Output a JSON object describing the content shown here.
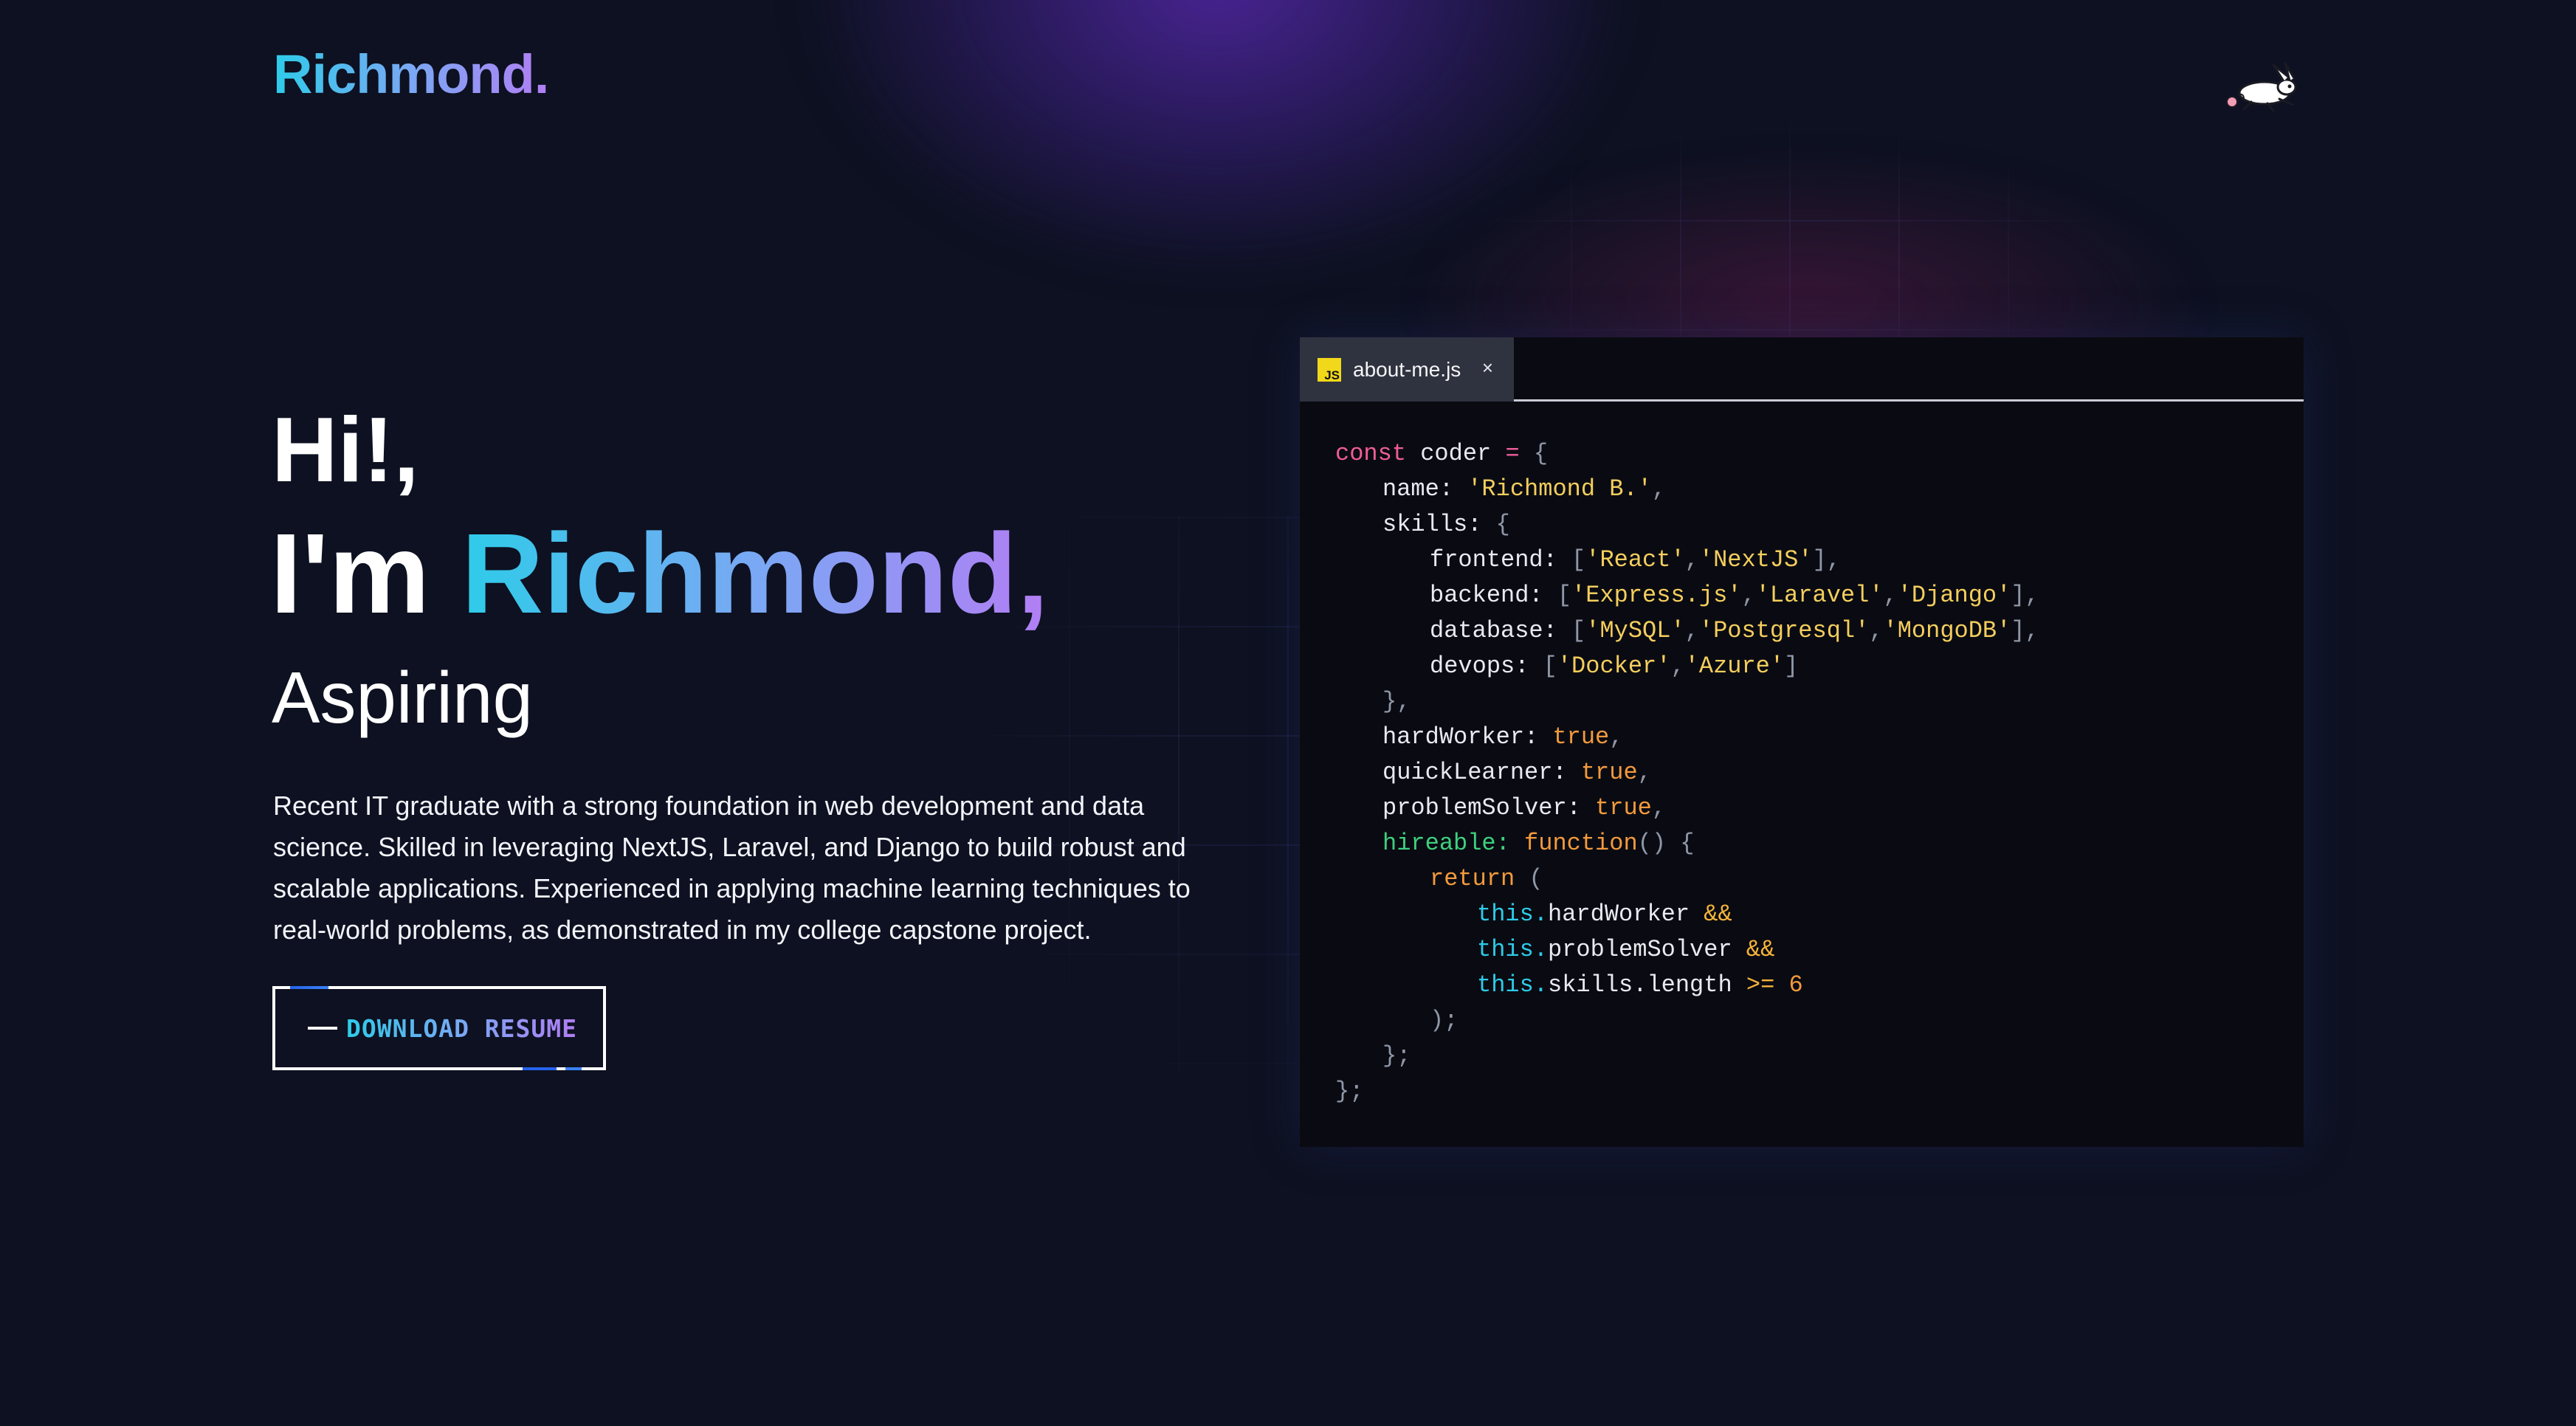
{
  "header": {
    "logo_text": "Richmond",
    "logo_dot": ".",
    "mascot_icon": "rabbit-icon"
  },
  "hero": {
    "greeting": "Hi!,",
    "intro_prefix": "I'm ",
    "name": "Richmond,",
    "role": "Aspiring",
    "bio": "Recent IT graduate with a strong foundation in web development and data science. Skilled in leveraging NextJS, Laravel, and Django to build robust and scalable applications. Experienced in applying machine learning techniques to real-world problems, as demonstrated in my college capstone project.",
    "resume_label": "DOWNLOAD RESUME"
  },
  "editor": {
    "tab_icon_text": "JS",
    "tab_name": "about-me.js",
    "close_glyph": "×",
    "code": {
      "const_kw": "const",
      "var_name": "coder",
      "eq": "=",
      "open_brace": "{",
      "name_key": "name:",
      "name_val": "'Richmond B.'",
      "skills_key": "skills:",
      "frontend_key": "frontend:",
      "frontend": [
        "'React'",
        "'NextJS'"
      ],
      "backend_key": "backend:",
      "backend": [
        "'Express.js'",
        "'Laravel'",
        "'Django'"
      ],
      "database_key": "database:",
      "database": [
        "'MySQL'",
        "'Postgresql'",
        "'MongoDB'"
      ],
      "devops_key": "devops:",
      "devops": [
        "'Docker'",
        "'Azure'"
      ],
      "close_skills": "},",
      "hardworker_key": "hardWorker:",
      "quicklearner_key": "quickLearner:",
      "problemsolver_key": "problemSolver:",
      "true_val": "true",
      "hireable_key": "hireable:",
      "function_kw": "function",
      "return_kw": "return",
      "this_kw": "this.",
      "prop_hardworker": "hardWorker",
      "prop_problemsolver": "problemSolver",
      "prop_skills_length": "skills.length",
      "and_op": "&&",
      "gte_op": ">=",
      "six": "6",
      "close_paren": ");",
      "close_fn": "};",
      "close_obj": "};"
    }
  },
  "colors": {
    "background": "#0d1121",
    "gradient_start": "#2ecbe9",
    "gradient_end": "#b27ef4",
    "editor_bg": "#0a0b12",
    "tab_bg": "#2f333f",
    "js_badge": "#f1d81b"
  }
}
